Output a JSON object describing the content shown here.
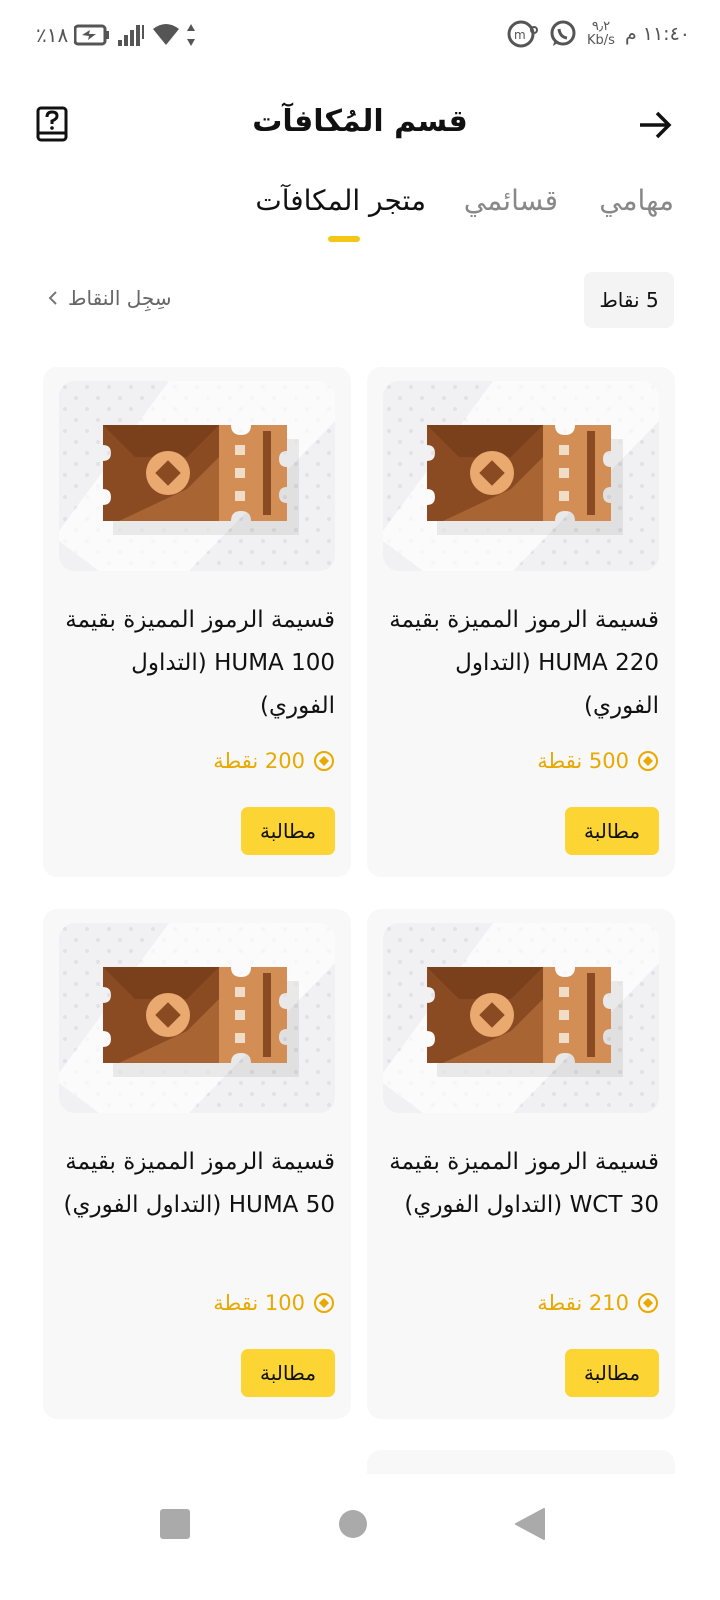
{
  "status_bar": {
    "battery": "٪١٨",
    "time": "١١:٤٠ م",
    "speed_value": "٩٫٢",
    "speed_unit": "Kb/s"
  },
  "header": {
    "title": "قسم المُكافآت"
  },
  "tabs": [
    {
      "label": "مهامي",
      "active": false
    },
    {
      "label": "قسائمي",
      "active": false
    },
    {
      "label": "متجر المكافآت",
      "active": true
    }
  ],
  "points": {
    "balance": "5 نقاط",
    "history_label": "سِجِل النقاط"
  },
  "cards": [
    {
      "title": "قسيمة الرموز المميزة بقيمة HUMA 220 (التداول الفوري)",
      "price": "500 نقطة",
      "claim_label": "مطالبة"
    },
    {
      "title": "قسيمة الرموز المميزة بقيمة HUMA 100 (التداول الفوري)",
      "price": "200 نقطة",
      "claim_label": "مطالبة"
    },
    {
      "title": "قسيمة الرموز المميزة بقيمة WCT 30 (التداول الفوري)",
      "price": "210 نقطة",
      "claim_label": "مطالبة"
    },
    {
      "title": "قسيمة الرموز المميزة بقيمة HUMA 50 (التداول الفوري)",
      "price": "100 نقطة",
      "claim_label": "مطالبة"
    }
  ],
  "colors": {
    "accent": "#fcd535",
    "price": "#e8a900",
    "ticket_dark": "#8a4a22",
    "ticket_light": "#d38e55"
  }
}
